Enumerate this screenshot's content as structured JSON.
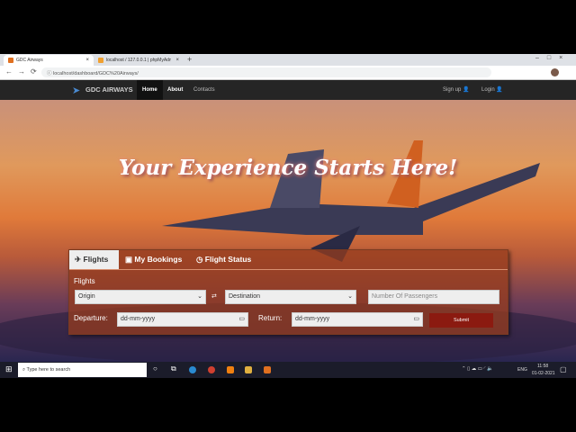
{
  "browser": {
    "tabs": [
      {
        "title": "GDC Airways",
        "active": true
      },
      {
        "title": "localhost / 127.0.0.1 | phpMyAdmin",
        "active": false
      }
    ],
    "new_tab": "+",
    "url": "localhost/dashboard/GDC%20Airways/"
  },
  "nav": {
    "brand": "GDC AIRWAYS",
    "links": [
      "Home",
      "About",
      "Contacts"
    ],
    "active": "Home",
    "signup": "Sign up",
    "login": "Login"
  },
  "hero": {
    "title": "Your Experience Starts Here!"
  },
  "booking": {
    "tabs": [
      "Flights",
      "My Bookings",
      "Flight Status"
    ],
    "active_tab": "Flights",
    "section_label": "Flights",
    "origin": "Origin",
    "swap": "⇄",
    "destination": "Destination",
    "passengers_placeholder": "Number Of Passengers",
    "departure_label": "Departure:",
    "departure_value": "dd-mm-yyyy",
    "return_label": "Return:",
    "return_value": "dd-mm-yyyy",
    "submit": "Submit"
  },
  "taskbar": {
    "search_placeholder": "Type here to search",
    "lang": "ENG",
    "time": "11:58",
    "date": "01-02-2021"
  },
  "colors": {
    "submit": "#8b1a10",
    "nav": "#252525"
  }
}
